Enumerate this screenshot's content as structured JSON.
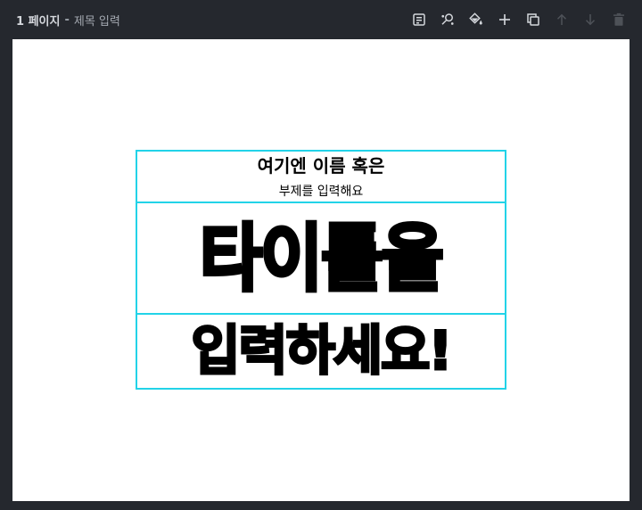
{
  "header": {
    "page_number": "1 페이지",
    "separator": "-",
    "page_title": "제목 입력"
  },
  "toolbar": {
    "icons": [
      "memo-icon",
      "magic-wand-icon",
      "paint-bucket-icon",
      "plus-icon",
      "duplicate-icon",
      "arrow-up-icon",
      "arrow-down-icon",
      "trash-icon"
    ]
  },
  "canvas": {
    "heading": "여기엔 이름 혹은",
    "subtitle": "부제를 입력해요",
    "title_line1": "타이틀을",
    "title_line2": "입력하세요!"
  },
  "colors": {
    "background": "#25282e",
    "canvas": "#ffffff",
    "selection": "#22d3e8",
    "icon": "#d4d7dc"
  }
}
